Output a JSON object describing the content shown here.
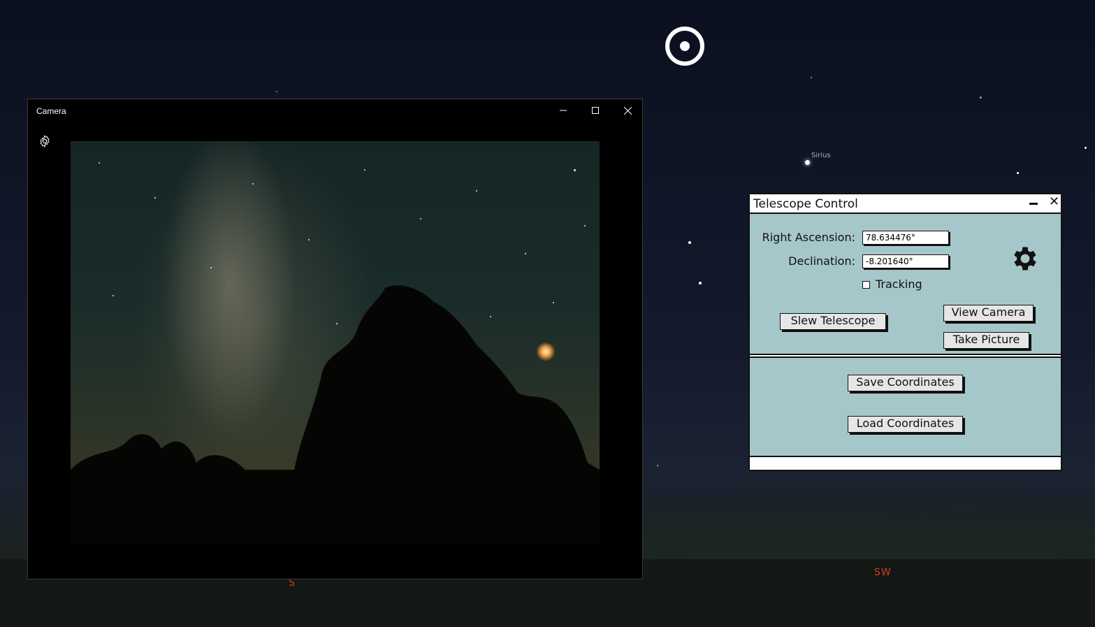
{
  "background": {
    "star_label": "Sirius",
    "compass": [
      "S",
      "SW"
    ]
  },
  "camera_window": {
    "title": "Camera",
    "controls": [
      "minimize",
      "maximize",
      "close"
    ]
  },
  "telescope_control": {
    "title": "Telescope Control",
    "right_ascension_label": "Right Ascension:",
    "right_ascension_value": "78.634476°",
    "declination_label": "Declination:",
    "declination_value": "-8.201640°",
    "tracking_label": "Tracking",
    "tracking_checked": false,
    "slew_button": "Slew Telescope",
    "view_camera_button": "View Camera",
    "take_picture_button": "Take Picture",
    "save_button": "Save Coordinates",
    "load_button": "Load Coordinates",
    "status_text": ""
  },
  "colors": {
    "panel": "#a6c7ca",
    "compass": "#d04020"
  }
}
